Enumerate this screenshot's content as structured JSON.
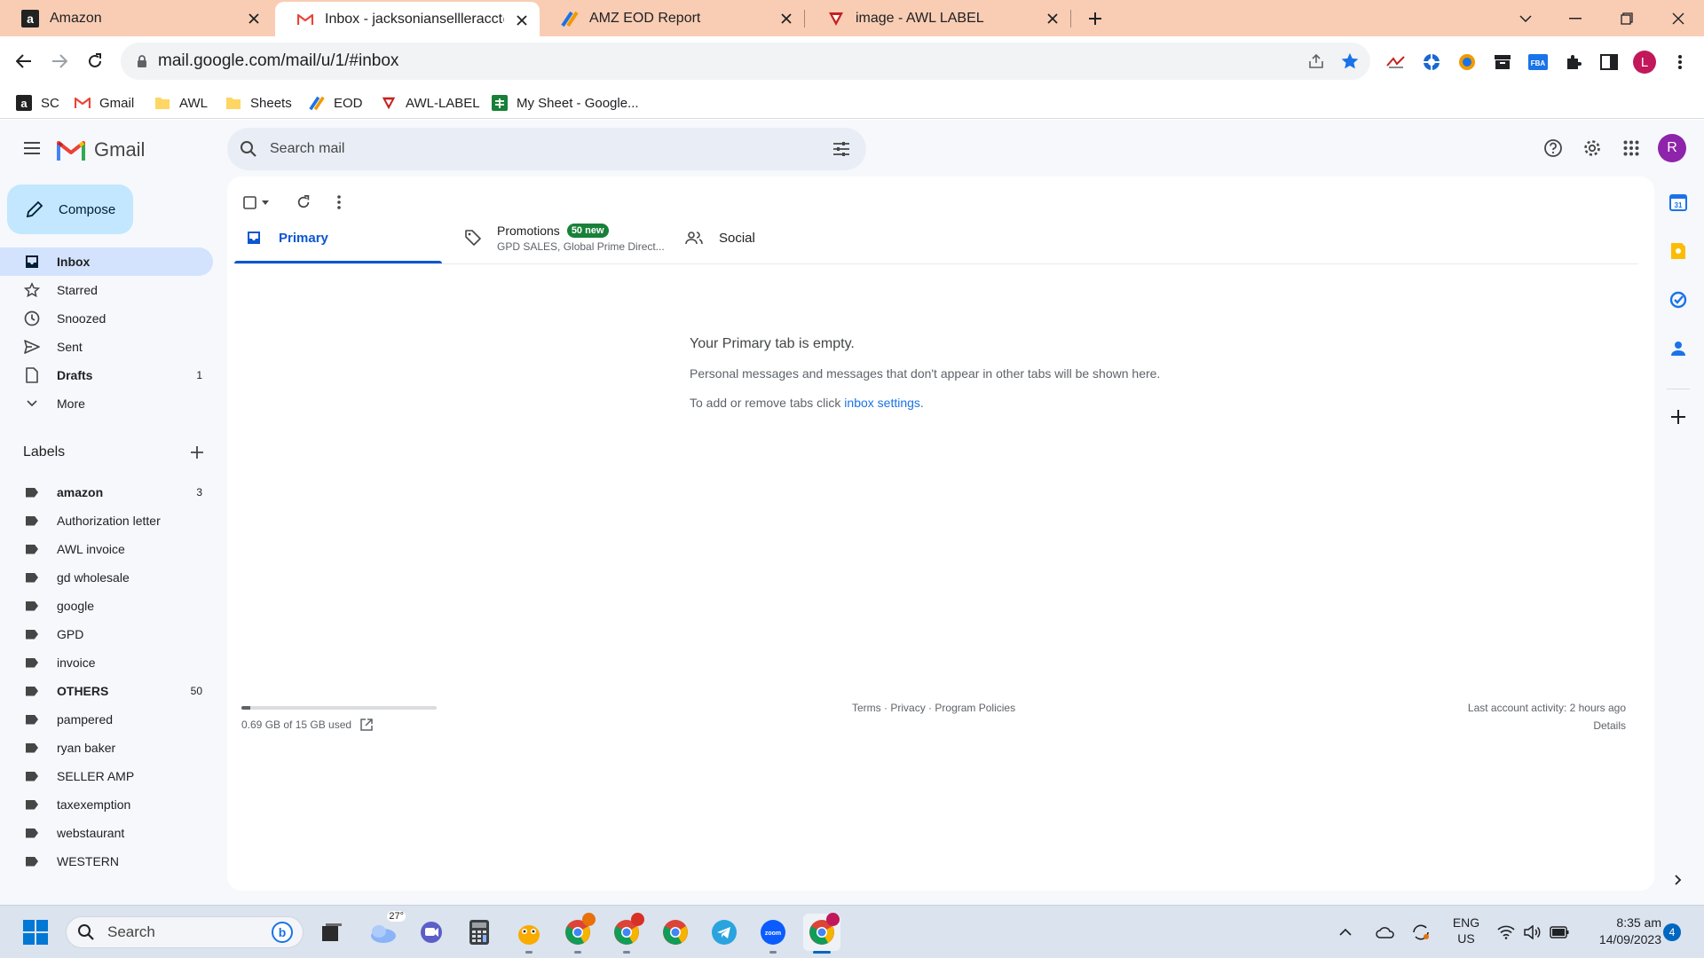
{
  "browser": {
    "tabs": [
      {
        "title": "Amazon",
        "favicon": "amazon-icon"
      },
      {
        "title": "Inbox - jacksoniansellleracct@gm",
        "favicon": "gmail-icon",
        "active": true
      },
      {
        "title": "AMZ EOD Report",
        "favicon": "eod-icon"
      },
      {
        "title": "image - AWL LABEL",
        "favicon": "awl-icon"
      }
    ],
    "url": "mail.google.com/mail/u/1/#inbox",
    "profile_initial": "L",
    "bookmarks": [
      {
        "label": "SC",
        "icon": "amazon-icon"
      },
      {
        "label": "Gmail",
        "icon": "gmail-icon"
      },
      {
        "label": "AWL",
        "icon": "folder-icon"
      },
      {
        "label": "Sheets",
        "icon": "folder-icon"
      },
      {
        "label": "EOD",
        "icon": "eod-icon"
      },
      {
        "label": "AWL-LABEL",
        "icon": "awl-icon"
      },
      {
        "label": "My Sheet - Google...",
        "icon": "sheets-icon"
      }
    ]
  },
  "gmail": {
    "brand": "Gmail",
    "search_placeholder": "Search mail",
    "account_initial": "R",
    "compose_label": "Compose",
    "nav": [
      {
        "label": "Inbox",
        "icon": "inbox-icon",
        "count": ""
      },
      {
        "label": "Starred",
        "icon": "star-icon",
        "count": ""
      },
      {
        "label": "Snoozed",
        "icon": "clock-icon",
        "count": ""
      },
      {
        "label": "Sent",
        "icon": "send-icon",
        "count": ""
      },
      {
        "label": "Drafts",
        "icon": "draft-icon",
        "count": "1"
      },
      {
        "label": "More",
        "icon": "chevron-down-icon",
        "count": ""
      }
    ],
    "labels_title": "Labels",
    "labels": [
      {
        "label": "amazon",
        "count": "3",
        "bold": true
      },
      {
        "label": "Authorization letter",
        "count": ""
      },
      {
        "label": "AWL invoice",
        "count": ""
      },
      {
        "label": "gd wholesale",
        "count": ""
      },
      {
        "label": "google",
        "count": ""
      },
      {
        "label": "GPD",
        "count": ""
      },
      {
        "label": "invoice",
        "count": ""
      },
      {
        "label": "OTHERS",
        "count": "50",
        "bold": true
      },
      {
        "label": "pampered",
        "count": ""
      },
      {
        "label": "ryan baker",
        "count": ""
      },
      {
        "label": "SELLER AMP",
        "count": ""
      },
      {
        "label": "taxexemption",
        "count": ""
      },
      {
        "label": "webstaurant",
        "count": ""
      },
      {
        "label": "WESTERN",
        "count": ""
      }
    ],
    "categories": {
      "primary": "Primary",
      "promotions": "Promotions",
      "promotions_badge": "50 new",
      "promotions_preview": "GPD SALES, Global Prime Direct...",
      "social": "Social"
    },
    "empty": {
      "title": "Your Primary tab is empty.",
      "line1": "Personal messages and messages that don't appear in other tabs will be shown here.",
      "line2_prefix": "To add or remove tabs click",
      "line2_link": "inbox settings",
      "line2_suffix": "."
    },
    "footer": {
      "storage_text": "0.69 GB of 15 GB used",
      "storage_fraction": 0.046,
      "terms": "Terms",
      "privacy": "Privacy",
      "program_policies": "Program Policies",
      "sep": "·",
      "last_activity": "Last account activity: 2 hours ago",
      "details": "Details"
    }
  },
  "taskbar": {
    "search_label": "Search",
    "weather_temp": "27°",
    "lang": "ENG",
    "region": "US",
    "time": "8:35 am",
    "date": "14/09/2023",
    "notification_count": "4"
  },
  "colors": {
    "tabstrip": "#f9cdb4",
    "accent_blue": "#0b57d0",
    "nav_selected": "#d3e3fd",
    "compose": "#c2e7ff",
    "promo_badge": "#188038",
    "profile": "#c2185b",
    "avatar": "#8e24aa"
  }
}
